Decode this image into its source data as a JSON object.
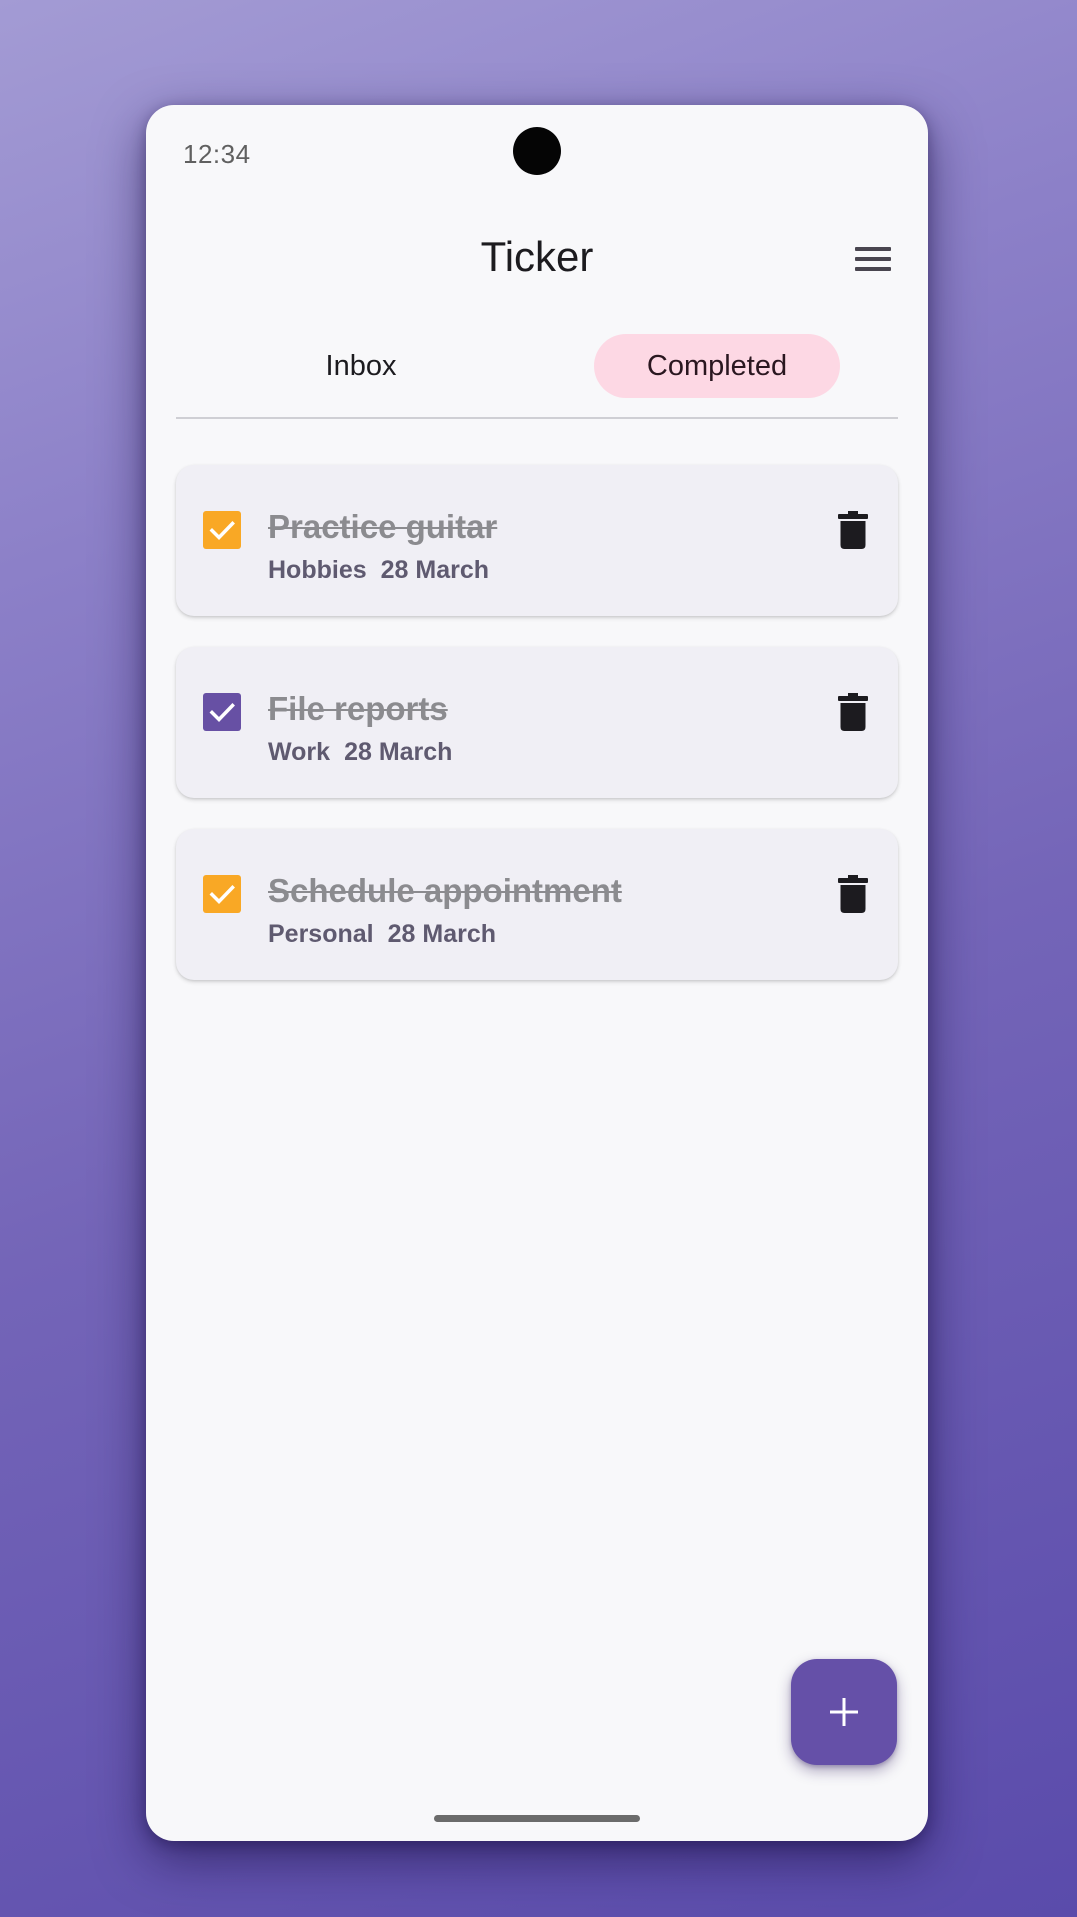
{
  "status_bar": {
    "time": "12:34"
  },
  "app": {
    "title": "Ticker",
    "menu_icon": "hamburger-menu-icon"
  },
  "tabs": [
    {
      "label": "Inbox",
      "selected": false
    },
    {
      "label": "Completed",
      "selected": true
    }
  ],
  "tasks": [
    {
      "title": "Practice guitar",
      "category": "Hobbies",
      "date": "28 March",
      "completed": true,
      "check_color": "#f9a825"
    },
    {
      "title": "File reports",
      "category": "Work",
      "date": "28 March",
      "completed": true,
      "check_color": "#6750a4"
    },
    {
      "title": "Schedule appointment",
      "category": "Personal",
      "date": "28 March",
      "completed": true,
      "check_color": "#f9a825"
    }
  ],
  "fab": {
    "icon": "plus-icon"
  },
  "colors": {
    "accent": "#6750a4",
    "selected_tab_bg": "#fdd8e4",
    "orange_check": "#f9a825",
    "purple_check": "#6750a4"
  }
}
